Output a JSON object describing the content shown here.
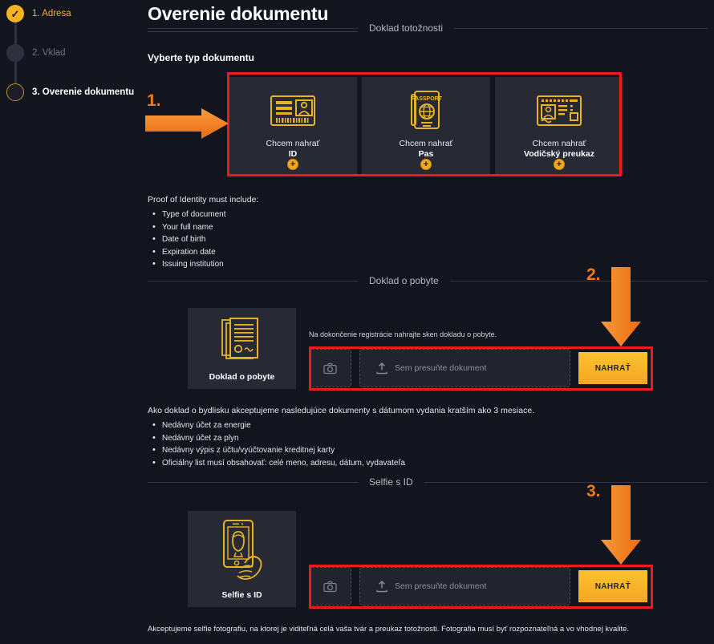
{
  "stepper": {
    "items": [
      {
        "label": "1. Adresa",
        "state": "done"
      },
      {
        "label": "2. Vklad",
        "state": "todo"
      },
      {
        "label": "3. Overenie dokumentu",
        "state": "current"
      }
    ]
  },
  "page": {
    "title": "Overenie dokumentu",
    "subhead": "Vyberte typ dokumentu"
  },
  "sections": {
    "identity": "Doklad totožnosti",
    "residence": "Doklad o pobyte",
    "selfie": "Selfie s ID"
  },
  "doc_cards": [
    {
      "line1": "Chcem nahrať",
      "line2": "ID",
      "icon": "id-card-icon",
      "plus": "+"
    },
    {
      "line1": "Chcem nahrať",
      "line2": "Pas",
      "icon": "passport-icon",
      "plus": "+"
    },
    {
      "line1": "Chcem nahrať",
      "line2": "Vodičský preukaz",
      "icon": "driving-licence-icon",
      "plus": "+"
    }
  ],
  "identity_list": {
    "intro": "Proof of Identity must include:",
    "items": [
      "Type of document",
      "Your full name",
      "Date of birth",
      "Expiration date",
      "Issuing institution"
    ]
  },
  "residence": {
    "tile_caption": "Doklad o pobyte",
    "hint": "Na dokončenie registrácie nahrajte sken dokladu o pobyte.",
    "dropzone_text": "Sem presuňte dokument",
    "upload_button": "NAHRAŤ"
  },
  "residence_list": {
    "intro": "Ako doklad o bydlisku akceptujeme nasledujúce dokumenty s dátumom vydania kratším ako 3 mesiace.",
    "items": [
      "Nedávny účet za energie",
      "Nedávny účet za plyn",
      "Nedávny výpis z účtu/vyúčtovanie kreditnej karty",
      "Oficiálny list musí obsahovať: celé meno, adresu, dátum, vydavateľa"
    ]
  },
  "selfie": {
    "tile_caption": "Selfie s ID",
    "dropzone_text": "Sem presuňte dokument",
    "upload_button": "NAHRAŤ"
  },
  "footnote": "Akceptujeme selfie fotografiu, na ktorej je viditeľná celá vaša tvár a preukaz totožnosti. Fotografia musí byť rozpoznateľná a vo vhodnej kvalite.",
  "annotations": {
    "step1": "1.",
    "step2": "2.",
    "step3": "3.",
    "highlight_color": "#ee1b1b",
    "arrow_color": "#f07a18"
  },
  "colors": {
    "background": "#12141e",
    "card": "#272a35",
    "accent_yellow": "#f5b321",
    "icon_gold": "#e6b422",
    "button_gradient_top": "#fbc22e",
    "button_gradient_bottom": "#f5a623"
  }
}
